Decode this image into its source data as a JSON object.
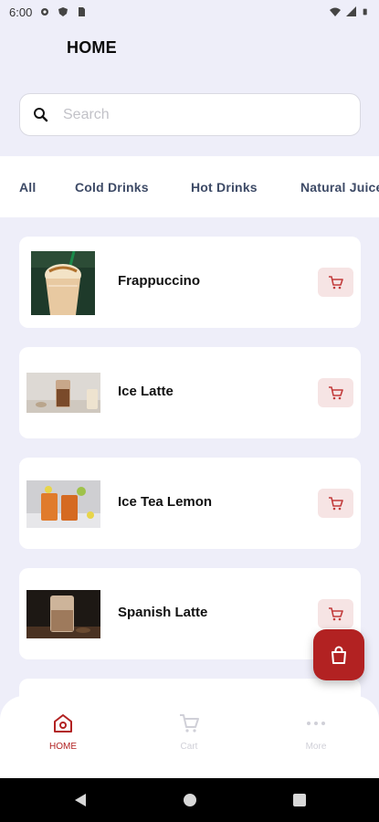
{
  "status_bar": {
    "time": "6:00"
  },
  "header": {
    "title": "HOME"
  },
  "search": {
    "placeholder": "Search"
  },
  "categories": [
    {
      "label": "All"
    },
    {
      "label": "Cold Drinks"
    },
    {
      "label": "Hot Drinks"
    },
    {
      "label": "Natural Juice"
    }
  ],
  "products": [
    {
      "name": "Frappuccino",
      "image_icon": "frappuccino-image"
    },
    {
      "name": "Ice Latte",
      "image_icon": "ice-latte-image"
    },
    {
      "name": "Ice Tea Lemon",
      "image_icon": "ice-tea-lemon-image"
    },
    {
      "name": "Spanish Latte",
      "image_icon": "spanish-latte-image"
    }
  ],
  "bottom_nav": {
    "items": [
      {
        "label": "HOME",
        "icon": "home-icon",
        "active": true
      },
      {
        "label": "Cart",
        "icon": "cart-icon",
        "active": false
      },
      {
        "label": "More",
        "icon": "more-icon",
        "active": false
      }
    ]
  },
  "colors": {
    "accent": "#B22222",
    "background": "#EEEEF9",
    "cart_button_bg": "#F6E4E4",
    "category_text": "#3D4A66",
    "inactive_nav": "#D0D0D8"
  }
}
